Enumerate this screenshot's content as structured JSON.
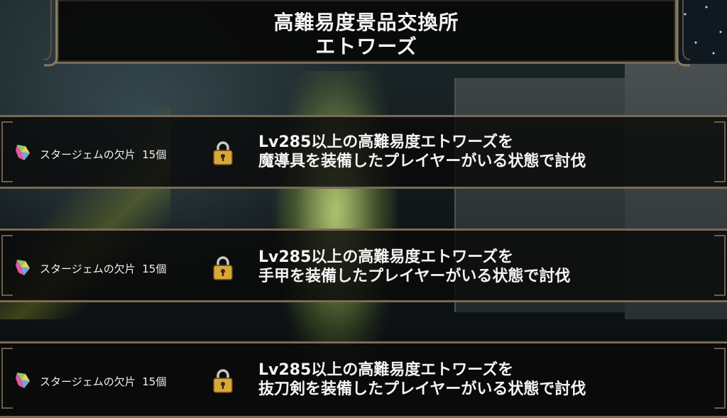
{
  "header": {
    "title_line1": "高難易度景品交換所",
    "title_line2": "エトワーズ"
  },
  "rewards": [
    {
      "item_icon": "star-gem-shard-icon",
      "item_label": "スタージェムの欠片",
      "quantity": "15個",
      "locked": true,
      "condition_line1": "Lv285以上の高難易度エトワーズを",
      "condition_line2": "魔導具を装備したプレイヤーがいる状態で討伐"
    },
    {
      "item_icon": "star-gem-shard-icon",
      "item_label": "スタージェムの欠片",
      "quantity": "15個",
      "locked": true,
      "condition_line1": "Lv285以上の高難易度エトワーズを",
      "condition_line2": "手甲を装備したプレイヤーがいる状態で討伐"
    },
    {
      "item_icon": "star-gem-shard-icon",
      "item_label": "スタージェムの欠片",
      "quantity": "15個",
      "locked": true,
      "condition_line1": "Lv285以上の高難易度エトワーズを",
      "condition_line2": "抜刀剣を装備したプレイヤーがいる状態で討伐"
    }
  ],
  "colors": {
    "frame": "#7a6a55",
    "panel": "#0a0a0a",
    "text": "#f4f4f4",
    "lock_gold": "#d8a83a"
  }
}
